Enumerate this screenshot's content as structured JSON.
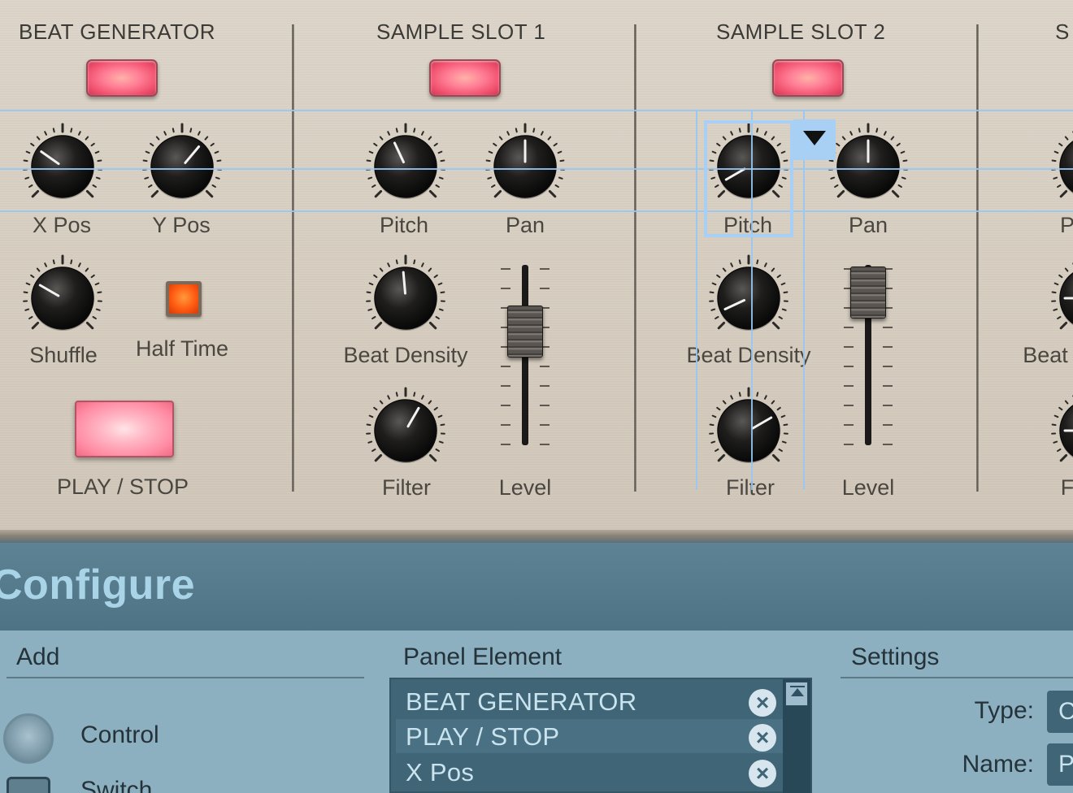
{
  "panel": {
    "sections": [
      {
        "title": "BEAT GENERATOR"
      },
      {
        "title": "SAMPLE SLOT 1"
      },
      {
        "title": "SAMPLE SLOT 2"
      },
      {
        "title": "S"
      }
    ],
    "beat_generator": {
      "x_pos_label": "X Pos",
      "y_pos_label": "Y Pos",
      "shuffle_label": "Shuffle",
      "half_time_label": "Half Time",
      "play_stop_label": "PLAY / STOP"
    },
    "slot1": {
      "pitch_label": "Pitch",
      "pan_label": "Pan",
      "beat_density_label": "Beat Density",
      "filter_label": "Filter",
      "level_label": "Level"
    },
    "slot2": {
      "pitch_label": "Pitch",
      "pan_label": "Pan",
      "beat_density_label": "Beat Density",
      "filter_label": "Filter",
      "level_label": "Level"
    },
    "slot3_partial": {
      "pitch_label": "P",
      "beat_density_label": "Beat",
      "filter_label": "F"
    }
  },
  "configure": {
    "title": "Configure",
    "add": {
      "header": "Add",
      "items": [
        {
          "label": "Control",
          "icon": "knob-icon"
        },
        {
          "label": "Switch",
          "icon": "switch-icon"
        }
      ]
    },
    "panel_element": {
      "header": "Panel Element",
      "items": [
        {
          "label": "BEAT GENERATOR"
        },
        {
          "label": "PLAY / STOP"
        },
        {
          "label": "X Pos"
        }
      ]
    },
    "settings": {
      "header": "Settings",
      "type_label": "Type:",
      "type_value": "C",
      "name_label": "Name:",
      "name_value": "P"
    }
  },
  "colors": {
    "led_pink": "#ff7f96",
    "half_time_orange": "#ff5a12",
    "configure_header": "#4d7384",
    "configure_body": "#8db0c1",
    "guide_blue": "#a8d0f5"
  }
}
